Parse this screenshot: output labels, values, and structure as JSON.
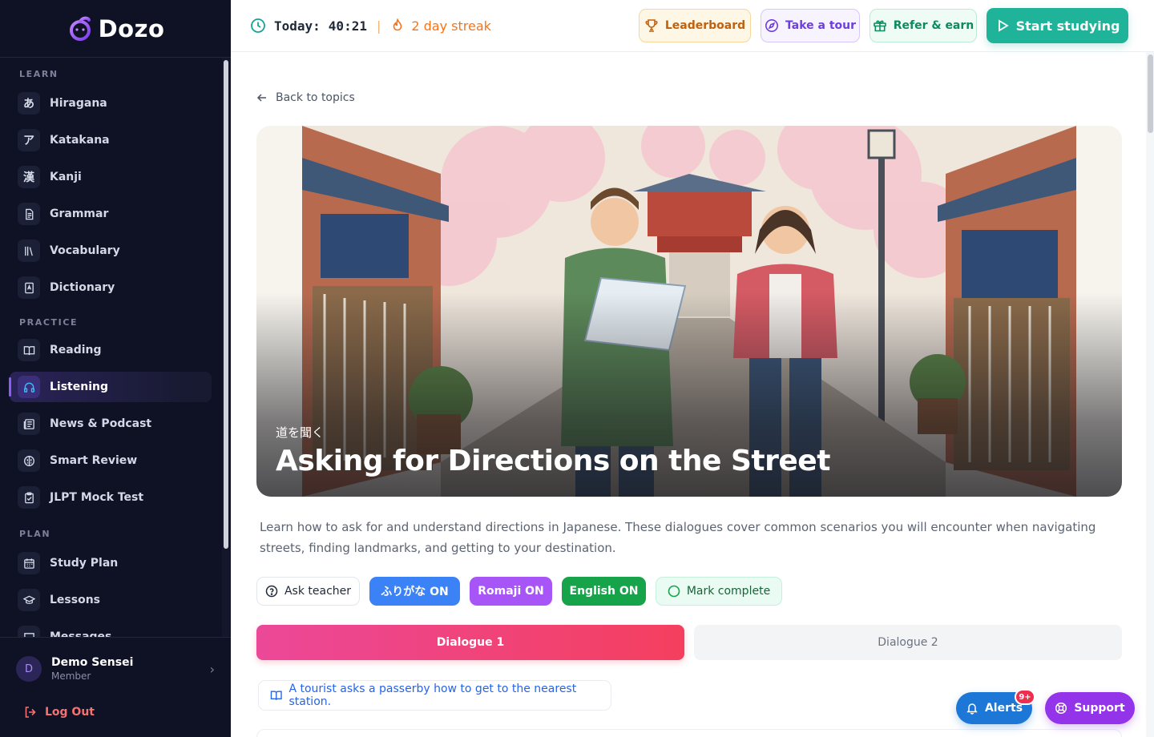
{
  "brand": {
    "name": "Dozo"
  },
  "sidebar": {
    "sections": [
      {
        "label": "LEARN",
        "items": [
          {
            "label": "Hiragana",
            "glyph": "あ",
            "icon": "hiragana-icon"
          },
          {
            "label": "Katakana",
            "glyph": "ア",
            "icon": "katakana-icon"
          },
          {
            "label": "Kanji",
            "glyph": "漢",
            "icon": "kanji-icon"
          },
          {
            "label": "Grammar",
            "icon": "document-icon"
          },
          {
            "label": "Vocabulary",
            "icon": "library-icon"
          },
          {
            "label": "Dictionary",
            "icon": "dictionary-icon"
          }
        ]
      },
      {
        "label": "PRACTICE",
        "items": [
          {
            "label": "Reading",
            "icon": "book-open-icon"
          },
          {
            "label": "Listening",
            "icon": "headphones-icon",
            "active": true
          },
          {
            "label": "News & Podcast",
            "icon": "newspaper-icon"
          },
          {
            "label": "Smart Review",
            "icon": "brain-icon"
          },
          {
            "label": "JLPT Mock Test",
            "icon": "clipboard-icon"
          }
        ]
      },
      {
        "label": "PLAN",
        "items": [
          {
            "label": "Study Plan",
            "icon": "calendar-icon"
          },
          {
            "label": "Lessons",
            "icon": "graduation-cap-icon"
          },
          {
            "label": "Messages",
            "icon": "message-icon"
          }
        ]
      }
    ],
    "user": {
      "initial": "D",
      "name": "Demo Sensei",
      "role": "Member"
    },
    "logout_label": "Log Out"
  },
  "topbar": {
    "today_label": "Today:",
    "today_time": "40:21",
    "streak_label": "2 day streak",
    "leaderboard_label": "Leaderboard",
    "tour_label": "Take a tour",
    "refer_label": "Refer & earn",
    "start_label": "Start studying"
  },
  "lesson": {
    "back_label": "Back to topics",
    "title_jp": "道を聞く",
    "title": "Asking for Directions on the Street",
    "description": "Learn how to ask for and understand directions in Japanese. These dialogues cover common scenarios you will encounter when navigating streets, finding landmarks, and getting to your destination.",
    "actions": {
      "ask_teacher": "Ask teacher",
      "furigana": "ふりがな ON",
      "romaji": "Romaji ON",
      "english": "English ON",
      "mark_complete": "Mark complete"
    },
    "tabs": [
      {
        "label": "Dialogue 1",
        "active": true
      },
      {
        "label": "Dialogue 2",
        "active": false
      }
    ],
    "scenario": "A tourist asks a passerby how to get to the nearest station."
  },
  "floating": {
    "alerts_label": "Alerts",
    "alerts_badge": "9+",
    "support_label": "Support"
  },
  "colors": {
    "sidebar_bg": "#0f1224",
    "accent_teal": "#1fb39a",
    "accent_purple": "#8b5cf6",
    "dialogue_active": "#f43f5e"
  }
}
